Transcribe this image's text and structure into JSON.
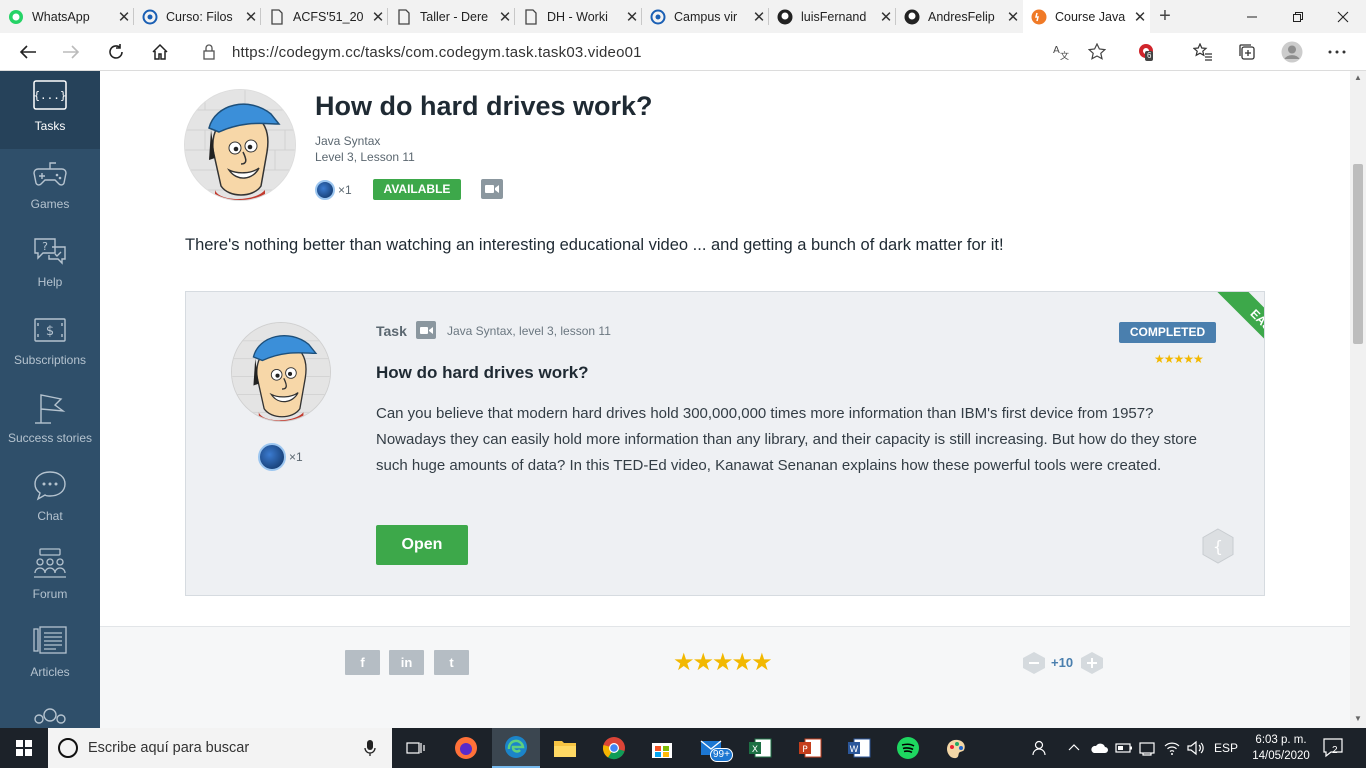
{
  "browser": {
    "tabs": [
      {
        "title": "WhatsApp",
        "icon": "whatsapp-icon"
      },
      {
        "title": "Curso: Filos",
        "icon": "moodle-icon"
      },
      {
        "title": "ACFS'51_20",
        "icon": "document-icon"
      },
      {
        "title": "Taller - Dere",
        "icon": "document-icon"
      },
      {
        "title": "DH - Worki",
        "icon": "document-icon"
      },
      {
        "title": "Campus vir",
        "icon": "moodle-icon"
      },
      {
        "title": "luisFernand",
        "icon": "github-icon"
      },
      {
        "title": "AndresFelip",
        "icon": "github-icon"
      },
      {
        "title": "Course Java",
        "icon": "codegym-icon"
      }
    ],
    "url": "https://codegym.cc/tasks/com.codegym.task.task03.video01",
    "extension_badge": "6"
  },
  "sidebar": {
    "items": [
      {
        "label": "Tasks",
        "icon": "tasks-icon"
      },
      {
        "label": "Games",
        "icon": "gamepad-icon"
      },
      {
        "label": "Help",
        "icon": "help-icon"
      },
      {
        "label": "Subscriptions",
        "icon": "subscriptions-icon"
      },
      {
        "label": "Success stories",
        "icon": "flag-icon"
      },
      {
        "label": "Chat",
        "icon": "chat-icon"
      },
      {
        "label": "Forum",
        "icon": "forum-icon"
      },
      {
        "label": "Articles",
        "icon": "articles-icon"
      }
    ]
  },
  "header": {
    "title": "How do hard drives work?",
    "course": "Java Syntax",
    "level_lesson": "Level 3, Lesson 11",
    "dark_matter": "×1",
    "status": "AVAILABLE"
  },
  "intro": "There's nothing better than watching an interesting educational video ... and getting a bunch of dark matter for it!",
  "card": {
    "type": "Task",
    "meta": "Java Syntax,  level 3,  lesson 11",
    "status": "COMPLETED",
    "difficulty": "EASY",
    "rating_stars": "★★★★★",
    "title": "How do hard drives work?",
    "description": "Can you believe that modern hard drives hold 300,000,000 times more information than IBM's first device from 1957? Nowadays they can easily hold more information than any library, and their capacity is still increasing. But how do they store such huge amounts of data? In this TED-Ed video, Kanawat Senanan explains how these powerful tools were created.",
    "dark_matter": "×1",
    "open_label": "Open"
  },
  "footer": {
    "share": [
      "f",
      "in",
      "t"
    ],
    "stars": "★★★★★",
    "score": "+10"
  },
  "taskbar": {
    "search_placeholder": "Escribe aquí para buscar",
    "language": "ESP",
    "time": "6:03 p. m.",
    "date": "14/05/2020",
    "mail_badge": "99+",
    "notifications": "2"
  },
  "colors": {
    "sidebar": "#2f4f6a",
    "green": "#3da84a",
    "blue_badge": "#4a7fae",
    "star": "#f2b800"
  }
}
